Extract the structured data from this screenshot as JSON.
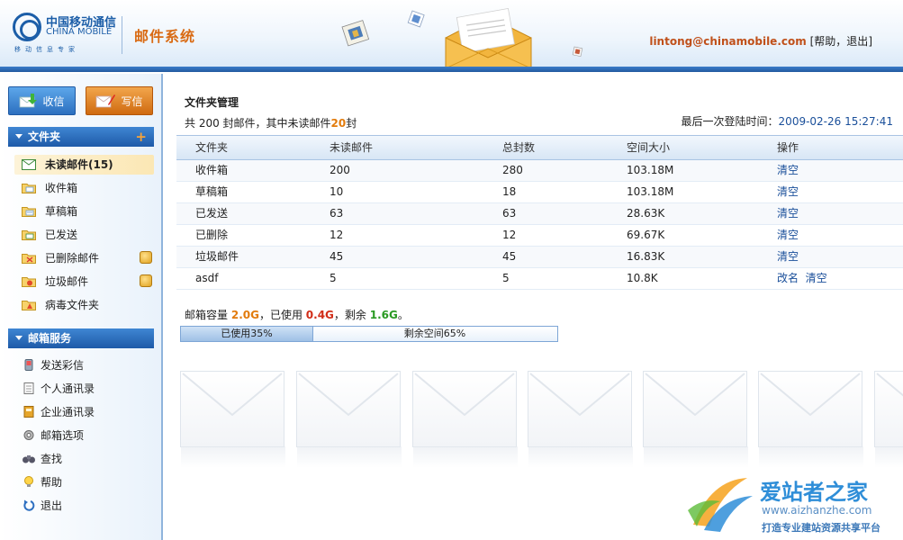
{
  "header": {
    "logo": {
      "cn": "中国移动通信",
      "en": "CHINA MOBILE",
      "sub": "移动信息专家"
    },
    "app_title": "邮件系统",
    "user_email": "lintong@chinamobile.com",
    "help_label": "帮助",
    "logout_label": "退出"
  },
  "sidebar": {
    "receive_label": "收信",
    "compose_label": "写信",
    "folders_title": "文件夹",
    "folders_add": "+",
    "folders": [
      {
        "label": "未读邮件(15)"
      },
      {
        "label": "收件箱"
      },
      {
        "label": "草稿箱"
      },
      {
        "label": "已发送"
      },
      {
        "label": "已删除邮件"
      },
      {
        "label": "垃圾邮件"
      },
      {
        "label": "病毒文件夹"
      }
    ],
    "services_title": "邮箱服务",
    "services": [
      {
        "label": "发送彩信"
      },
      {
        "label": "个人通讯录"
      },
      {
        "label": "企业通讯录"
      },
      {
        "label": "邮箱选项"
      },
      {
        "label": "查找"
      },
      {
        "label": "帮助"
      },
      {
        "label": "退出"
      }
    ]
  },
  "main": {
    "title": "文件夹管理",
    "summary": {
      "prefix": "共 200 封邮件，其中未读邮件",
      "unread": "20",
      "suffix": "封"
    },
    "last_login": {
      "label": "最后一次登陆时间：",
      "time": "2009-02-26 15:27:41"
    },
    "table": {
      "headers": [
        "文件夹",
        "未读邮件",
        "总封数",
        "空间大小",
        "操作"
      ],
      "rows": [
        {
          "folder": "收件箱",
          "unread": "200",
          "total": "280",
          "size": "103.18M",
          "actions": [
            "清空"
          ]
        },
        {
          "folder": "草稿箱",
          "unread": "10",
          "total": "18",
          "size": "103.18M",
          "actions": [
            "清空"
          ]
        },
        {
          "folder": "已发送",
          "unread": "63",
          "total": "63",
          "size": "28.63K",
          "actions": [
            "清空"
          ]
        },
        {
          "folder": "已删除",
          "unread": "12",
          "total": "12",
          "size": "69.67K",
          "actions": [
            "清空"
          ]
        },
        {
          "folder": "垃圾邮件",
          "unread": "45",
          "total": "45",
          "size": "16.83K",
          "actions": [
            "清空"
          ]
        },
        {
          "folder": "asdf",
          "unread": "5",
          "total": "5",
          "size": "10.8K",
          "actions": [
            "改名",
            "清空"
          ]
        }
      ]
    },
    "quota": {
      "capacity_label": "邮箱容量",
      "capacity": "2.0G",
      "used_label": "，已使用",
      "used": "0.4G",
      "left_label": "，剩余",
      "left": "1.6G",
      "end": "。",
      "used_percent": 35,
      "used_text": "已使用35%",
      "left_text": "剩余空间65%"
    },
    "watermark": {
      "title": "爱站者之家",
      "url": "www.aizhanzhe.com",
      "sub": "打造专业建站资源共享平台"
    }
  },
  "colors": {
    "brand_blue": "#1c5ea8",
    "title_orange": "#d96a13",
    "link_blue": "#1a4f9a",
    "used_red": "#d12d18",
    "left_green": "#2a9a23"
  }
}
